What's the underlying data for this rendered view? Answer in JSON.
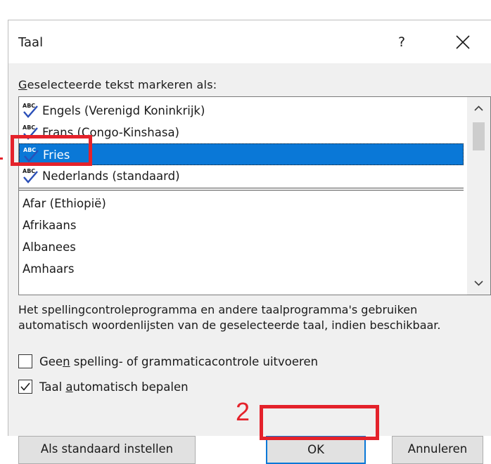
{
  "dialog": {
    "title": "Taal",
    "help_label": "?",
    "close_icon": "close-icon"
  },
  "list": {
    "label_accesskey": "G",
    "label_rest": "eselecteerde tekst markeren als:",
    "items": [
      {
        "label": "Engels (Verenigd Koninkrijk)",
        "proofing": true,
        "selected": false
      },
      {
        "label": "Frans (Congo-Kinshasa)",
        "proofing": true,
        "selected": false
      },
      {
        "label": "Fries",
        "proofing": true,
        "selected": true
      },
      {
        "label": "Nederlands (standaard)",
        "proofing": true,
        "selected": false
      },
      {
        "label": "Afar (Ethiopië)",
        "proofing": false,
        "selected": false
      },
      {
        "label": "Afrikaans",
        "proofing": false,
        "selected": false
      },
      {
        "label": "Albanees",
        "proofing": false,
        "selected": false
      },
      {
        "label": "Amhaars",
        "proofing": false,
        "selected": false
      }
    ]
  },
  "description": "Het spellingcontroleprogramma en andere taalprogramma's gebruiken automatisch woordenlijsten van de geselecteerde taal, indien beschikbaar.",
  "options": {
    "no_proofing": {
      "pre": "Gee",
      "key": "n",
      "post": " spelling- of grammaticacontrole uitvoeren",
      "checked": false
    },
    "auto_detect": {
      "pre": "Taal ",
      "key": "a",
      "post": "utomatisch bepalen",
      "checked": true
    }
  },
  "buttons": {
    "set_default": "Als standaard instellen",
    "ok": "OK",
    "cancel": "Annuleren"
  },
  "annotations": {
    "step2_label": "2",
    "color": "#e4222b"
  },
  "colors": {
    "selection": "#0a78d7",
    "dialog_bg": "#f0f0f0"
  }
}
